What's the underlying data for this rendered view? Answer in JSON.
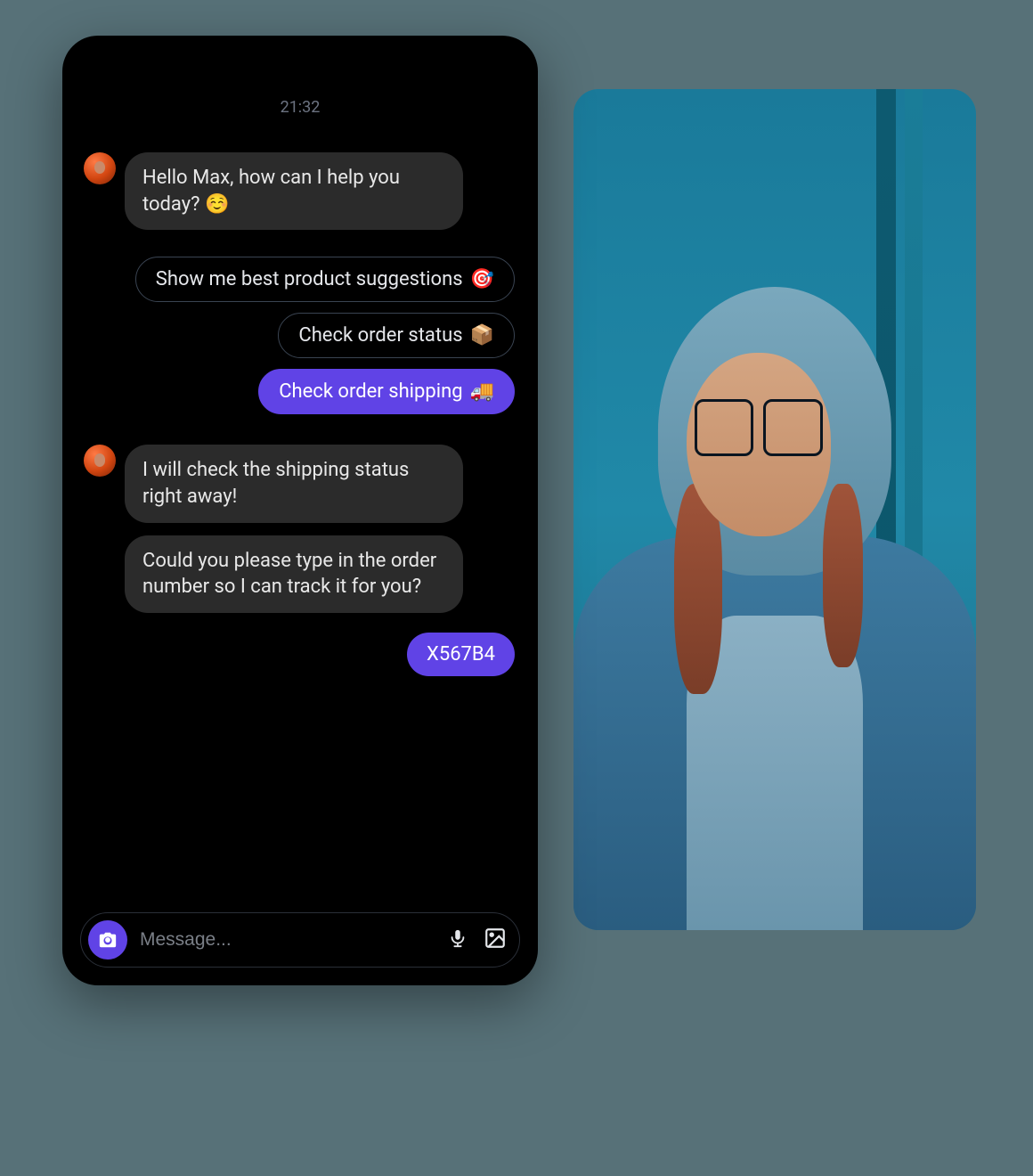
{
  "timestamp": "21:32",
  "bot": {
    "greeting": "Hello Max, how can I help you today? ☺️",
    "reply1": "I will check the shipping status right away!",
    "reply2": "Could you please type in the order number so I can track it for you?"
  },
  "suggestions": {
    "opt1": {
      "label": "Show me best product suggestions",
      "emoji": "🎯"
    },
    "opt2": {
      "label": "Check order status",
      "emoji": "📦"
    },
    "opt3": {
      "label": "Check order shipping",
      "emoji": "🚚"
    }
  },
  "user": {
    "order_code": "X567B4"
  },
  "input": {
    "placeholder": "Message..."
  },
  "colors": {
    "accent": "#6043e6",
    "bubble": "#2b2b2b"
  }
}
